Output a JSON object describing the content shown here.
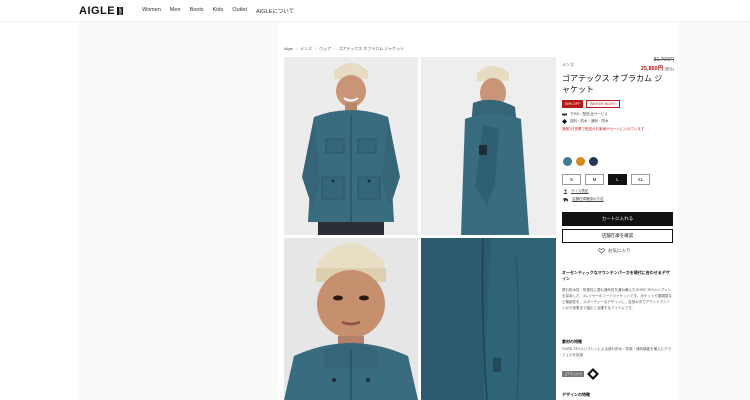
{
  "header": {
    "logo": "AIGLE",
    "logo_badge": "1853",
    "nav": [
      "Women",
      "Men",
      "Boots",
      "Kids",
      "Outlet",
      "AIGLEについて"
    ]
  },
  "breadcrumb": [
    "Aigle",
    "メンズ",
    "ウェア",
    "ゴアテックス オブラカム ジャケット"
  ],
  "product": {
    "category": "メンズ",
    "price_old": "$1,700円",
    "price_new": "25,850円",
    "price_tax": "(税込)",
    "title": "ゴアテックス オブラカム ジャケット",
    "badge_discount": "50% OFF",
    "badge_sale": "WINTER NIGHT",
    "info_1": "下代5・配送:全サービス",
    "info_2": "送料・防水・通気・防水",
    "notice": "通常2日営業で配送のお客様がカートに入れています",
    "colors": [
      "#3e7a90",
      "#d68a1e",
      "#27355a"
    ],
    "sizes": [
      "S",
      "M",
      "L",
      "XL"
    ],
    "selected_size": "L",
    "link_size_guide": "サイズ表記",
    "link_store_stock": "店舗在庫確認の方法",
    "cart_button": "カートに入れる",
    "store_button": "店舗在庫を確認",
    "favorite": "お気に入り"
  },
  "description": {
    "heading": "オーセンティックなマウンテンパーカを現代に合わせるデザイン",
    "body": "優れ防水性・防風性に優れ通気性を兼ね備えたGORE-TEXメンブレンを採用した、3レイヤーのフードジャケットです。ポケットや裾調整など機能性を、スポーティーなデザインに、自然の中でアウトドアシーンから街着まで幅広く活躍するアイテムです。",
    "feature_heading": "素材の特徴",
    "feature_text": "GORE-TEXメンブレンによる優れ防水・防風・通気機能を備えたグラフェネを採用",
    "tag": "ゴアテックス",
    "design_heading": "デザインの特徴"
  },
  "icons": {
    "info_icon_1": "ruler-icon",
    "info_icon_2": "diamond-icon",
    "size_guide_icon": "person-icon",
    "store_icon": "truck-icon",
    "favorite_icon": "heart-icon"
  }
}
